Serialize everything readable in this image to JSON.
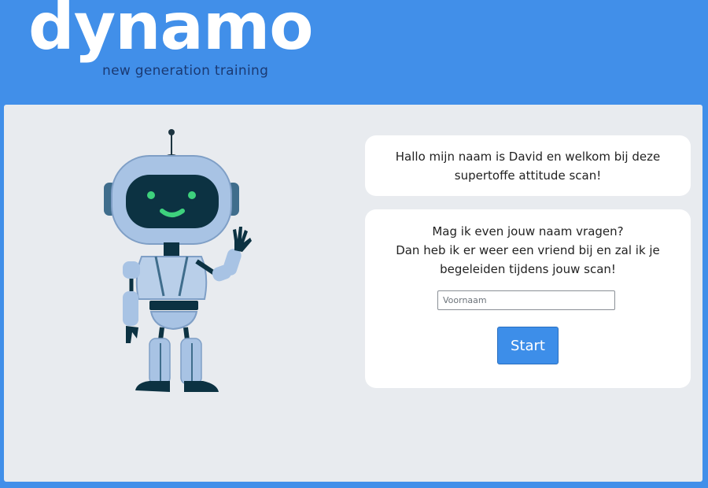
{
  "header": {
    "logo_word": "dynamo",
    "logo_tagline": "new generation training"
  },
  "greeting": {
    "text": "Hallo mijn naam is David en welkom bij deze supertoffe attitude scan!"
  },
  "name_prompt": {
    "line1": "Mag ik even jouw naam vragen?",
    "line2": "Dan heb ik er weer een vriend bij en zal ik je begeleiden tijdens jouw scan!",
    "input_placeholder": "Voornaam",
    "input_value": "",
    "start_label": "Start"
  },
  "colors": {
    "brand_blue": "#418fe9",
    "button_blue": "#3d8ee9",
    "panel_bg": "#e8ebef",
    "tagline": "#1b3a73"
  },
  "icons": {
    "mascot": "robot-waving"
  }
}
